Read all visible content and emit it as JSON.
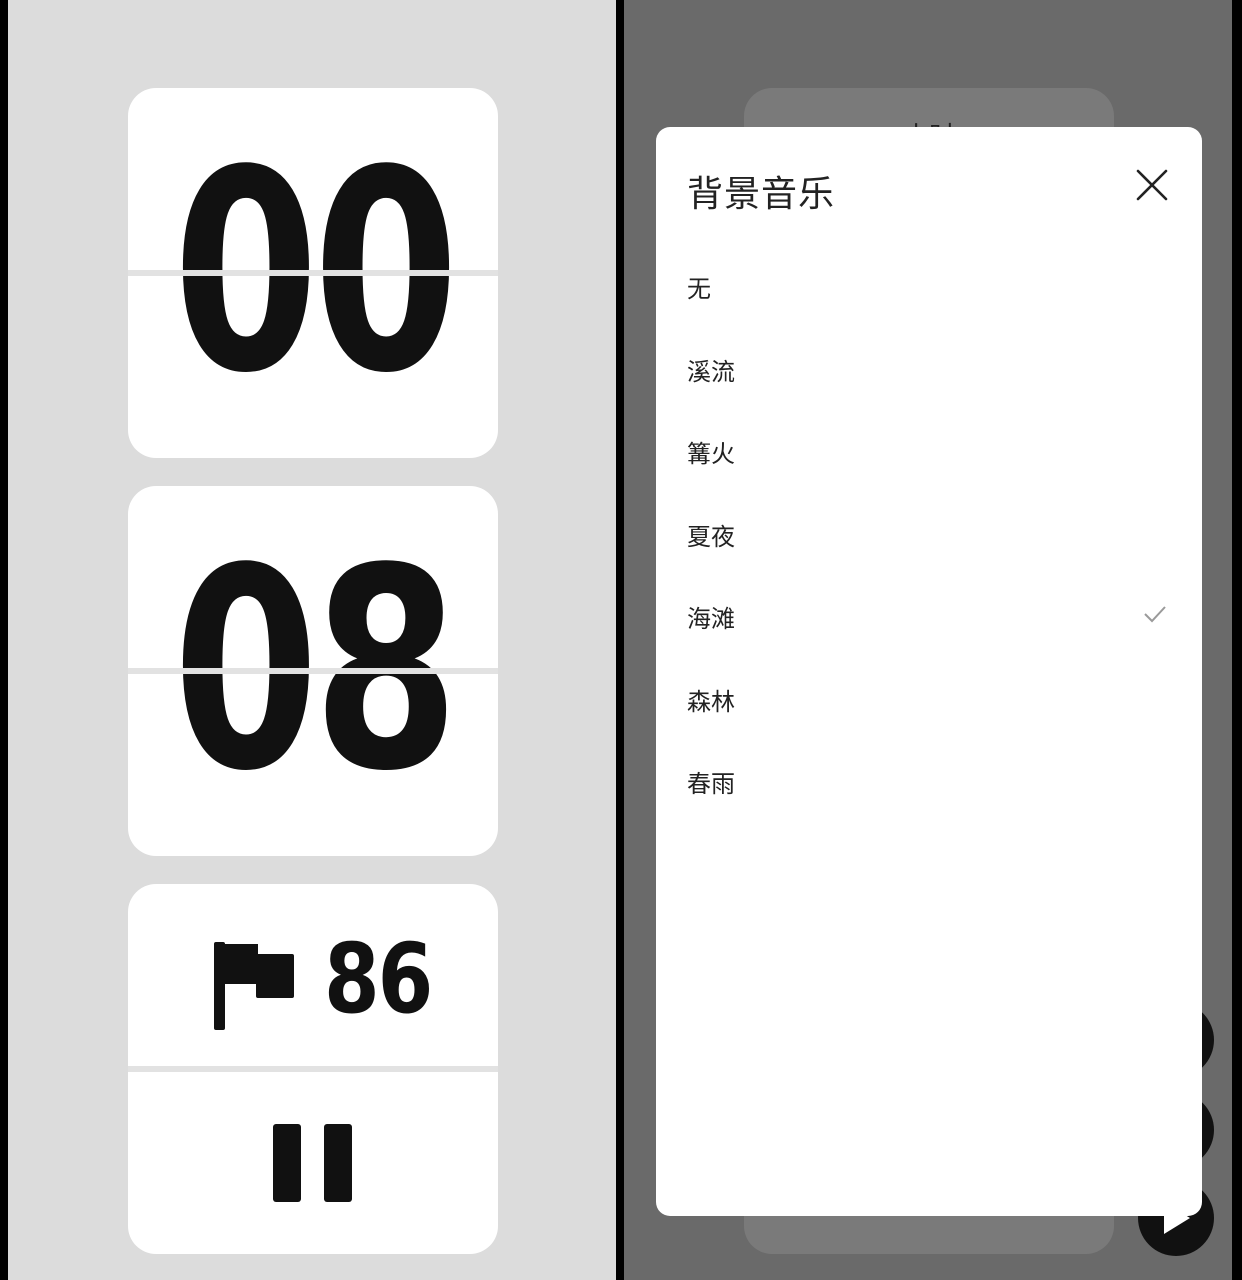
{
  "left": {
    "hours": "00",
    "minutes": "08",
    "count": "86"
  },
  "right": {
    "behind_label": "小时"
  },
  "modal": {
    "title": "背景音乐",
    "options": [
      {
        "label": "无",
        "selected": false
      },
      {
        "label": "溪流",
        "selected": false
      },
      {
        "label": "篝火",
        "selected": false
      },
      {
        "label": "夏夜",
        "selected": false
      },
      {
        "label": "海滩",
        "selected": true
      },
      {
        "label": "森林",
        "selected": false
      },
      {
        "label": "春雨",
        "selected": false
      }
    ]
  },
  "colors": {
    "left_bg": "#dcdcdc",
    "right_overlay": "#6a6a6a",
    "card": "#ffffff",
    "digit": "#111111",
    "check": "#9a9a9a"
  },
  "icons": {
    "flag": "flag-icon",
    "pause": "pause-icon",
    "close": "close-icon",
    "check": "check-icon",
    "play": "play-icon"
  }
}
